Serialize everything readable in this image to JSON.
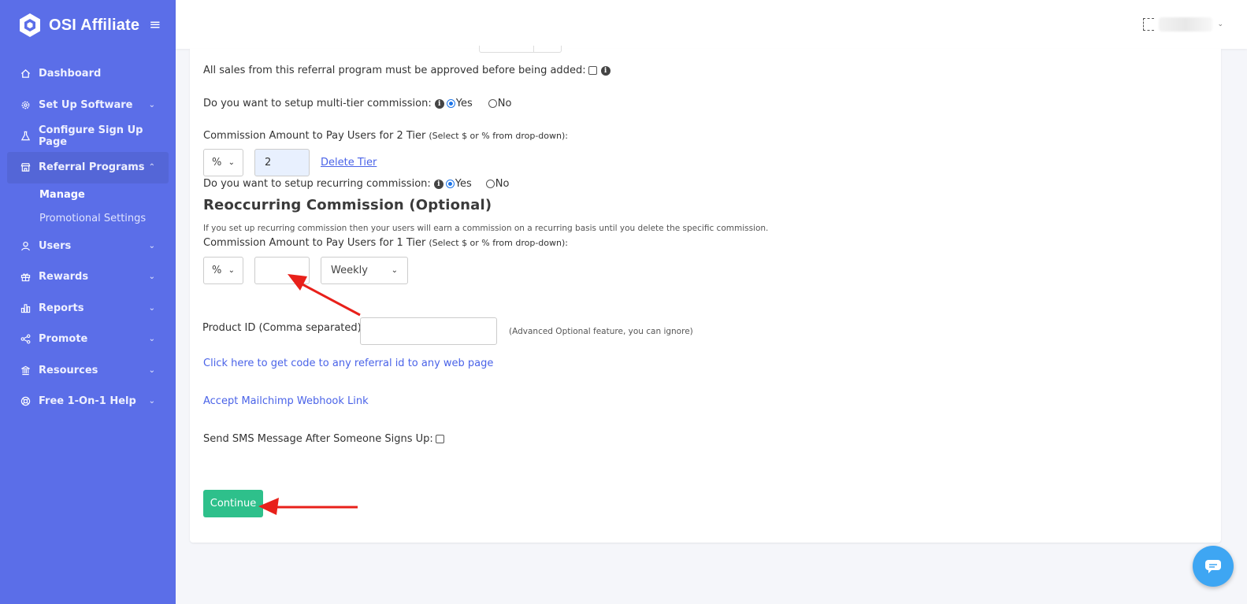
{
  "app": {
    "name": "OSI Affiliate"
  },
  "sidebar": {
    "items": [
      {
        "label": "Dashboard",
        "icon": "home-icon",
        "expandable": false
      },
      {
        "label": "Set Up Software",
        "icon": "gear-icon",
        "expandable": true
      },
      {
        "label": "Configure Sign Up Page",
        "icon": "flask-icon",
        "expandable": false
      },
      {
        "label": "Referral Programs",
        "icon": "store-icon",
        "expandable": true,
        "expanded": true,
        "children": [
          {
            "label": "Manage",
            "current": true
          },
          {
            "label": "Promotional Settings"
          }
        ]
      },
      {
        "label": "Users",
        "icon": "user-icon",
        "expandable": true
      },
      {
        "label": "Rewards",
        "icon": "gift-icon",
        "expandable": true
      },
      {
        "label": "Reports",
        "icon": "bar-chart-icon",
        "expandable": true
      },
      {
        "label": "Promote",
        "icon": "share-icon",
        "expandable": true
      },
      {
        "label": "Resources",
        "icon": "bank-icon",
        "expandable": true
      },
      {
        "label": "Free 1-On-1 Help",
        "icon": "lifebuoy-icon",
        "expandable": true
      }
    ]
  },
  "form": {
    "approve_label": "All sales from this referral program must be approved before being added:",
    "multi_tier_label": "Do you want to setup multi-tier commission:",
    "yes": "Yes",
    "no": "No",
    "tier2_label": "Commission Amount to Pay Users for 2 Tier",
    "tier_hint": "(Select $ or % from drop-down):",
    "tier2_type": "%",
    "tier2_value": "2",
    "delete_tier": "Delete Tier",
    "recurring_label": "Do you want to setup recurring commission:",
    "recurring_heading": "Reoccurring Commission (Optional)",
    "recurring_desc": "If you set up recurring commission then your users will earn a commission on a recurring basis until you delete the specific commission.",
    "tier1_label": "Commission Amount to Pay Users for 1 Tier",
    "tier1_type": "%",
    "tier1_value": "",
    "frequency": "Weekly",
    "product_id_label": "Product ID (Comma separated):",
    "product_id_value": "",
    "product_id_hint": "(Advanced Optional feature, you can ignore)",
    "code_link": "Click here to get code to any referral id to any web page",
    "mailchimp_link": "Accept Mailchimp Webhook Link",
    "sms_label": "Send SMS Message After Someone Signs Up:",
    "continue": "Continue"
  },
  "colors": {
    "sidebar": "#5b6ee8",
    "accent": "#2ec08b",
    "link": "#4a63e8",
    "annotation_arrow": "#e8201a"
  }
}
